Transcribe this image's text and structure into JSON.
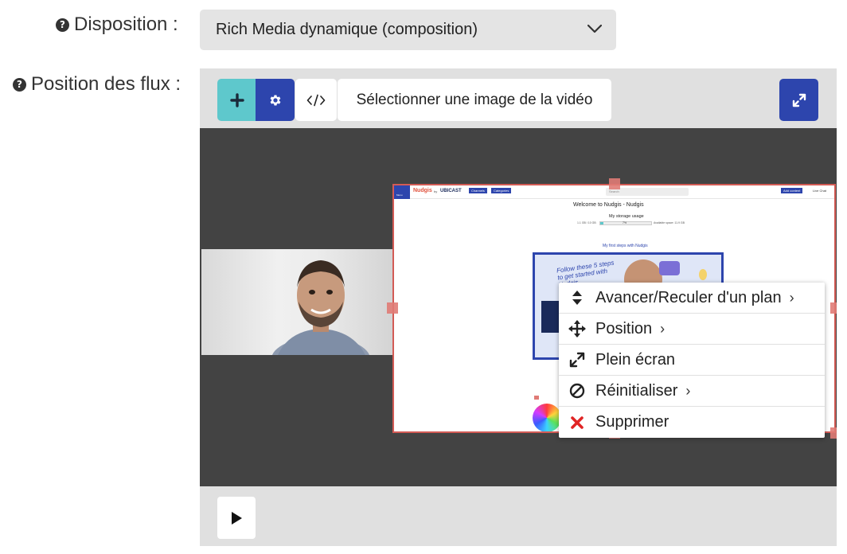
{
  "disposition": {
    "label": "Disposition :",
    "selected": "Rich Media dynamique (composition)"
  },
  "position": {
    "label": "Position des flux :"
  },
  "toolbar": {
    "add_icon": "plus-icon",
    "settings_icon": "gear-icon",
    "code_icon": "code-icon",
    "select_image_label": "Sélectionner une image de la vidéo",
    "fullscreen_icon": "expand-icon"
  },
  "screen_stream": {
    "brand": "Nudgis",
    "brand_by": "by",
    "brand_company": "UBICAST",
    "nav_channels": "Channels",
    "nav_categories": "Categories",
    "menu_label": "Menu",
    "search_placeholder": "Search",
    "add_content": "Add content",
    "user": "Live Chat",
    "welcome_title": "Welcome to Nudgis - Nudgis",
    "storage_title": "My storage usage",
    "storage_used": "1.1 GB / 10 GB",
    "storage_percent": "7%",
    "storage_available": "Available space: 11.9 GB",
    "first_steps": "My first steps with Nudgis",
    "banner_text": "Follow these 5 steps to get started with Nudgis"
  },
  "context_menu": {
    "items": [
      {
        "label": "Avancer/Reculer d'un plan",
        "icon": "sort-icon",
        "submenu": true
      },
      {
        "label": "Position",
        "icon": "move-icon",
        "submenu": true
      },
      {
        "label": "Plein écran",
        "icon": "expand-icon",
        "submenu": false
      },
      {
        "label": "Réinitialiser",
        "icon": "ban-icon",
        "submenu": true
      },
      {
        "label": "Supprimer",
        "icon": "close-icon",
        "submenu": false
      }
    ]
  },
  "player": {
    "play_icon": "play-icon"
  },
  "colors": {
    "teal": "#5ec8cc",
    "blue": "#2d45ad",
    "stage": "#434343",
    "selection": "#d35b55",
    "delete": "#e02424"
  }
}
